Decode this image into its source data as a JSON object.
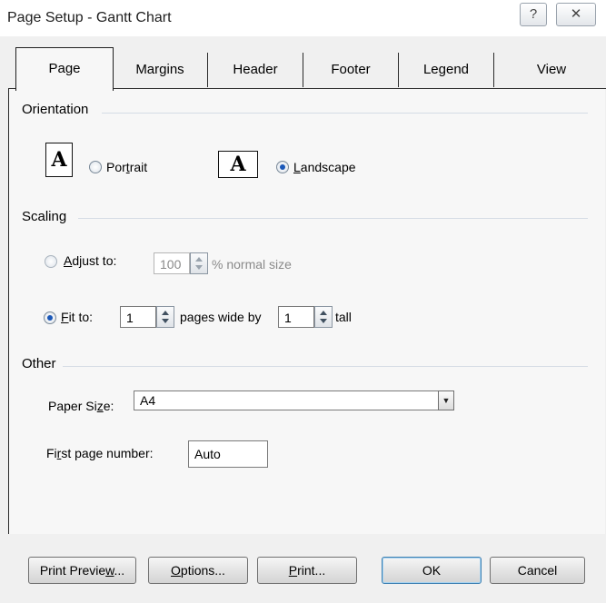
{
  "window": {
    "title": "Page Setup - Gantt Chart",
    "help_glyph": "?",
    "close_glyph": "✕"
  },
  "tabs": [
    "Page",
    "Margins",
    "Header",
    "Footer",
    "Legend",
    "View"
  ],
  "orientation": {
    "group_label": "Orientation",
    "icon_letter": "A",
    "portrait": {
      "label_pre": "Por",
      "label_key": "t",
      "label_post": "rait",
      "selected": false
    },
    "landscape": {
      "label_pre": "",
      "label_key": "L",
      "label_post": "andscape",
      "selected": true
    }
  },
  "scaling": {
    "group_label": "Scaling",
    "adjust": {
      "label_pre": "",
      "label_key": "A",
      "label_post": "djust to:",
      "value": "100",
      "suffix": "% normal size",
      "selected": false
    },
    "fit": {
      "label_pre": "",
      "label_key": "F",
      "label_post": "it to:",
      "wide_value": "1",
      "mid_text": "pages wide by",
      "tall_value": "1",
      "suffix": "tall",
      "selected": true
    }
  },
  "other": {
    "group_label": "Other",
    "paper_size": {
      "label_pre": "Paper Si",
      "label_key": "z",
      "label_post": "e:",
      "value": "A4"
    },
    "first_page": {
      "label_pre": "Fi",
      "label_key": "r",
      "label_post": "st page number:",
      "value": "Auto"
    }
  },
  "buttons": {
    "print_preview": {
      "pre": "Print Previe",
      "key": "w",
      "post": "..."
    },
    "options": {
      "pre": "",
      "key": "O",
      "post": "ptions..."
    },
    "print": {
      "pre": "",
      "key": "P",
      "post": "rint..."
    },
    "ok": "OK",
    "cancel": "Cancel"
  },
  "colors": {
    "accent": "#1b58b8",
    "panel": "#f7f7f7",
    "dialog": "#f0f0f0"
  }
}
